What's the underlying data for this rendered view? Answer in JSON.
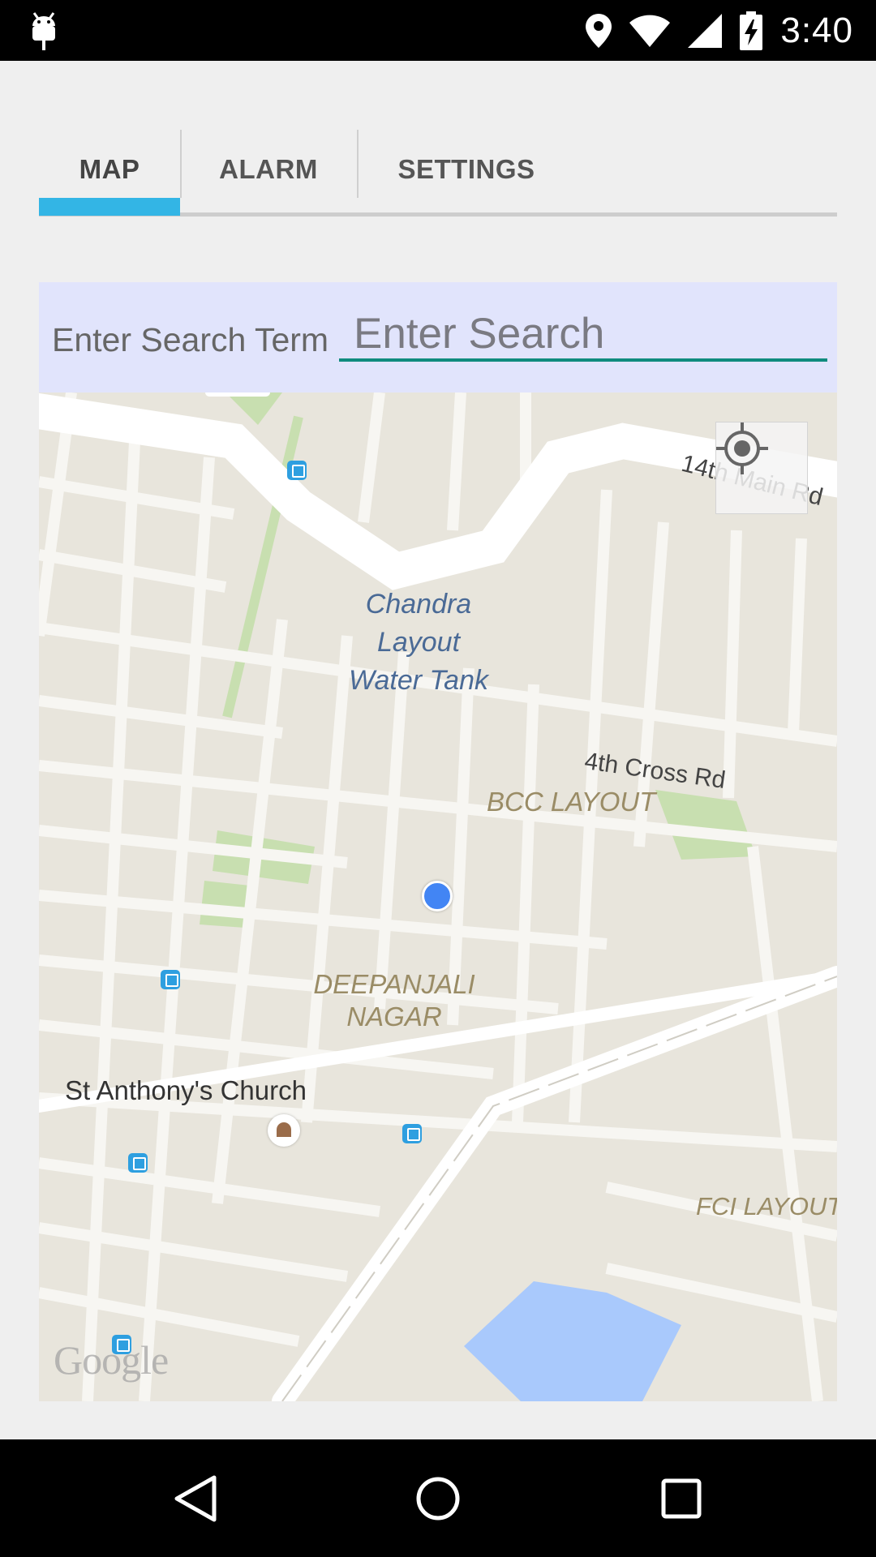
{
  "status_bar": {
    "time": "3:40",
    "icons": [
      "android-debug-icon",
      "location-icon",
      "wifi-icon",
      "signal-icon",
      "battery-charging-icon"
    ]
  },
  "tabs": [
    {
      "label": "MAP",
      "selected": true
    },
    {
      "label": "ALARM",
      "selected": false
    },
    {
      "label": "SETTINGS",
      "selected": false
    }
  ],
  "search": {
    "label": "Enter Search Term",
    "placeholder": "Enter Search",
    "value": ""
  },
  "map": {
    "labels": {
      "water_tank": [
        "Chandra",
        "Layout",
        "Water Tank"
      ],
      "bcc_layout": "BCC LAYOUT",
      "deepanjali": [
        "DEEPANJALI",
        "NAGAR"
      ],
      "fci_layout": "FCI LAYOUT",
      "church": "St Anthony's Church",
      "road_4th_cross": "4th Cross Rd",
      "road_14th_main": "14th Main Rd",
      "attribution": "Google"
    },
    "colors": {
      "land": "#e8e5dc",
      "road": "#ffffff",
      "park": "#c8dfb0",
      "water": "#a9c9fc",
      "location_dot": "#4285f4",
      "bus_stop": "#2e9fe0"
    }
  },
  "colors": {
    "tab_indicator": "#33b5e5",
    "search_background": "#e1e4fc",
    "search_underline": "#0f8b7e"
  },
  "nav_bar": {
    "icons": [
      "back-icon",
      "home-icon",
      "recents-icon"
    ]
  }
}
